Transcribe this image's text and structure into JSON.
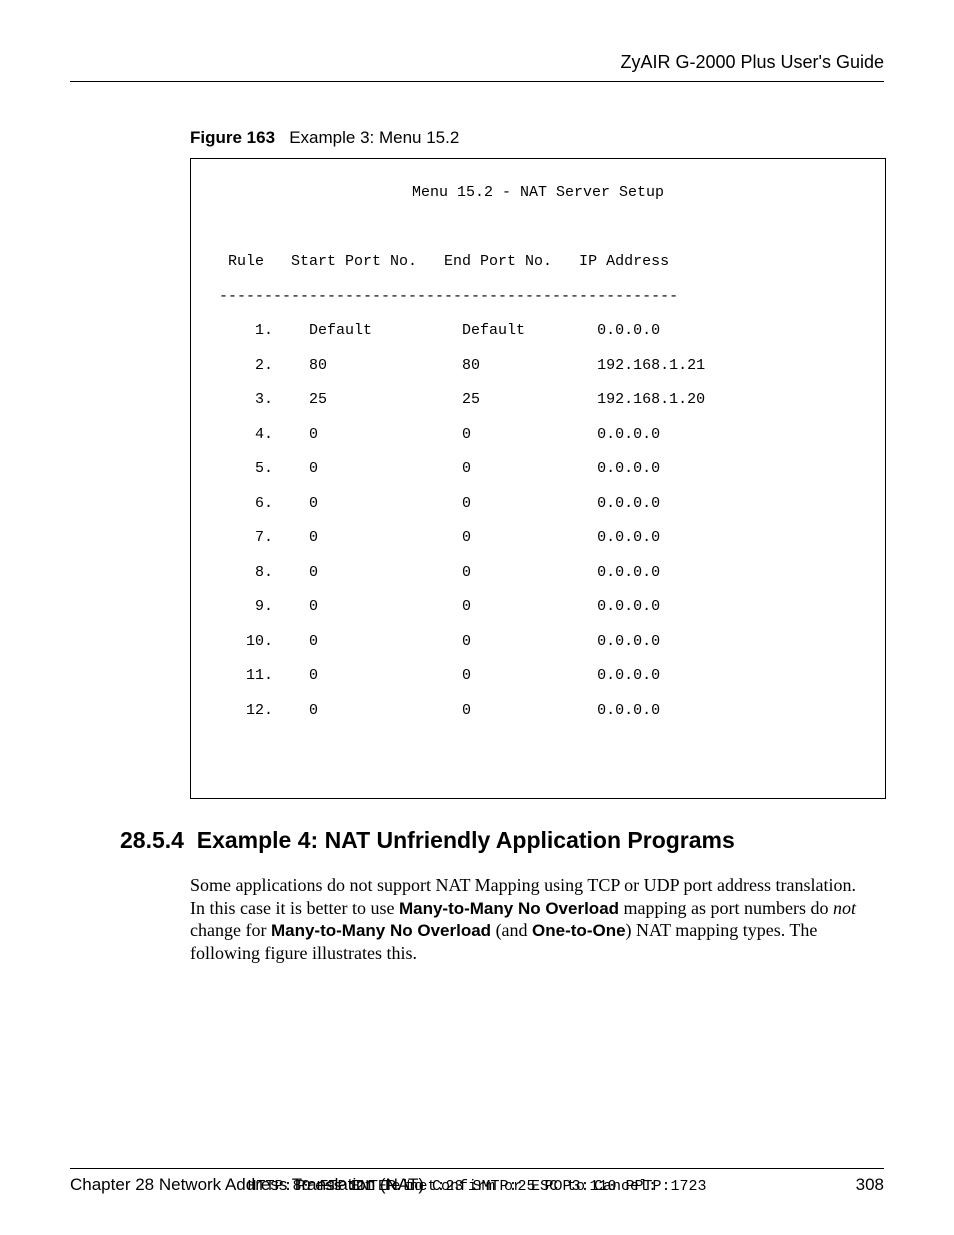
{
  "header": {
    "guide_title": "ZyAIR G-2000 Plus User's Guide"
  },
  "figure": {
    "label": "Figure 163",
    "caption": "Example 3: Menu 15.2",
    "menu_title": "Menu 15.2 - NAT Server Setup",
    "columns": "   Rule   Start Port No.   End Port No.   IP Address",
    "divider": "  ---------------------------------------------------",
    "rows": [
      "      1.    Default          Default        0.0.0.0",
      "      2.    80               80             192.168.1.21",
      "      3.    25               25             192.168.1.20",
      "      4.    0                0              0.0.0.0",
      "      5.    0                0              0.0.0.0",
      "      6.    0                0              0.0.0.0",
      "      7.    0                0              0.0.0.0",
      "      8.    0                0              0.0.0.0",
      "      9.    0                0              0.0.0.0",
      "     10.    0                0              0.0.0.0",
      "     11.    0                0              0.0.0.0",
      "     12.    0                0              0.0.0.0"
    ],
    "prompt": "Press ENTER to Confirm or ESC to Cancel:",
    "ports": "HTTP:80 FTP:21 Telnet:23 SMTP:25 POP3:110 PPTP:1723"
  },
  "section": {
    "number": "28.5.4",
    "title": "Example 4: NAT Unfriendly Application Programs",
    "p1_a": "Some applications do not support NAT Mapping using TCP or UDP port address translation. In this case it is better to use ",
    "p1_b1": "Many-to-Many No Overload",
    "p1_c": " mapping as port numbers do ",
    "p1_i": "not",
    "p1_d": " change for ",
    "p1_b2": "Many-to-Many No Overload",
    "p1_e": " (and ",
    "p1_b3": "One-to-One",
    "p1_f": ") NAT mapping types. The following figure illustrates this."
  },
  "footer": {
    "chapter": "Chapter 28 Network Address Translation (NAT)",
    "page": "308"
  }
}
